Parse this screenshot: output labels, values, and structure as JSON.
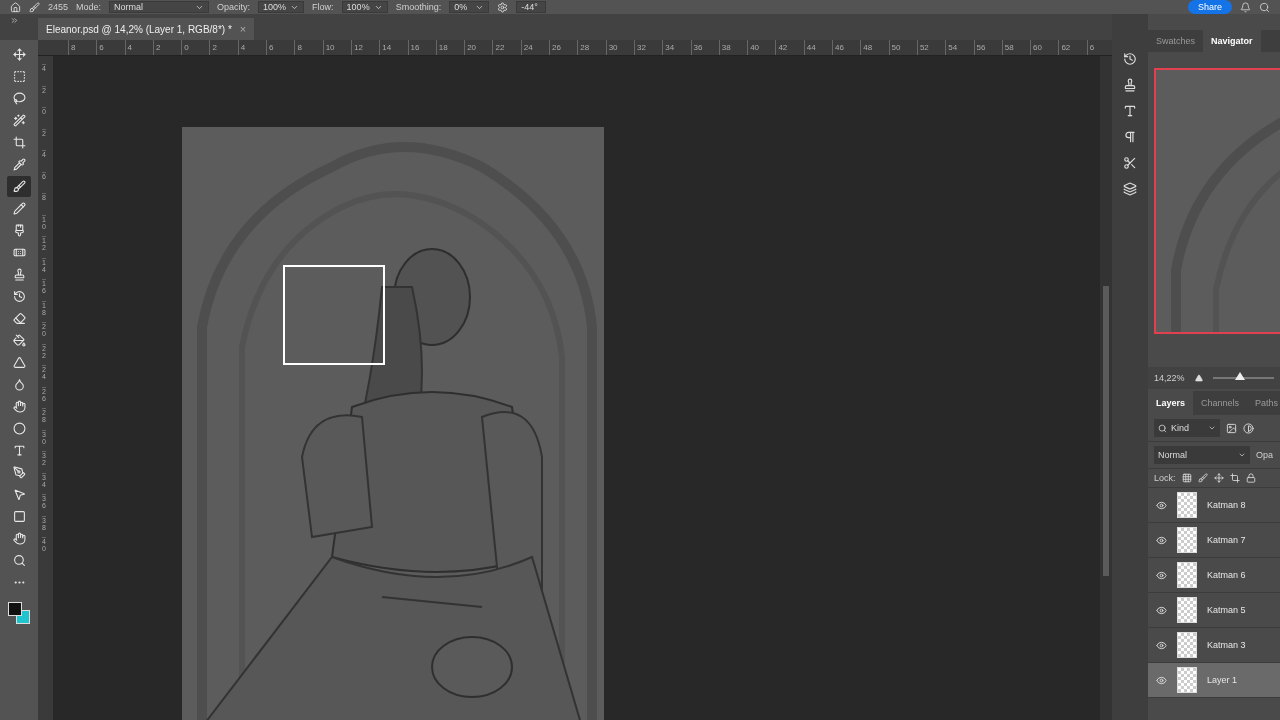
{
  "options_bar": {
    "brush_size": "2455",
    "mode_label": "Mode:",
    "mode": "Normal",
    "opacity_label": "Opacity:",
    "opacity": "100%",
    "flow_label": "Flow:",
    "flow": "100%",
    "smoothing_label": "Smoothing:",
    "smoothing": "0%",
    "angle": "-44°",
    "share": "Share"
  },
  "document_tab": {
    "title": "Eleanor.psd @ 14,2% (Layer 1, RGB/8*) *",
    "close": "×"
  },
  "tools": [
    {
      "kind": "move",
      "selected": false
    },
    {
      "kind": "marquee",
      "selected": false
    },
    {
      "kind": "lasso",
      "selected": false
    },
    {
      "kind": "wand",
      "selected": false
    },
    {
      "kind": "crop",
      "selected": false
    },
    {
      "kind": "eyedropper",
      "selected": false
    },
    {
      "kind": "brush",
      "selected": true
    },
    {
      "kind": "pencil",
      "selected": false
    },
    {
      "kind": "mixer",
      "selected": false
    },
    {
      "kind": "healing",
      "selected": false
    },
    {
      "kind": "stamp",
      "selected": false
    },
    {
      "kind": "history",
      "selected": false
    },
    {
      "kind": "eraser",
      "selected": false
    },
    {
      "kind": "bucket",
      "selected": false
    },
    {
      "kind": "blur",
      "selected": false
    },
    {
      "kind": "drop",
      "selected": false
    },
    {
      "kind": "smudge",
      "selected": false
    },
    {
      "kind": "sponge",
      "selected": false
    },
    {
      "kind": "type",
      "selected": false
    },
    {
      "kind": "pen",
      "selected": false
    },
    {
      "kind": "select",
      "selected": false
    },
    {
      "kind": "rect",
      "selected": false
    },
    {
      "kind": "hand",
      "selected": false
    },
    {
      "kind": "zoom",
      "selected": false
    },
    {
      "kind": "more",
      "selected": false
    }
  ],
  "ruler_h": [
    "8",
    "6",
    "4",
    "2",
    "0",
    "2",
    "4",
    "6",
    "8",
    "10",
    "12",
    "14",
    "16",
    "18",
    "20",
    "22",
    "24",
    "26",
    "28",
    "30",
    "32",
    "34",
    "36",
    "38",
    "40",
    "42",
    "44",
    "46",
    "48",
    "50",
    "52",
    "54",
    "56",
    "58",
    "60",
    "62",
    "6"
  ],
  "ruler_v": [
    "4",
    "2",
    "0",
    "2",
    "4",
    "6",
    "8",
    "10",
    "12",
    "14",
    "16",
    "18",
    "20",
    "22",
    "24",
    "26",
    "28",
    "30",
    "32",
    "34",
    "36",
    "38",
    "40"
  ],
  "navigator": {
    "tabs": [
      {
        "label": "Swatches",
        "selected": false
      },
      {
        "label": "Navigator",
        "selected": true
      }
    ],
    "zoom": "14,22%",
    "level": 0.45
  },
  "layers_panel": {
    "tabs": [
      {
        "label": "Layers",
        "selected": true
      },
      {
        "label": "Channels",
        "selected": false
      },
      {
        "label": "Paths",
        "selected": false
      }
    ],
    "filter": "Kind",
    "blend": "Normal",
    "opacity_label": "Opa",
    "lock_label": "Lock:",
    "layers": [
      {
        "name": "Katman 8",
        "visible": true,
        "selected": false
      },
      {
        "name": "Katman 7",
        "visible": true,
        "selected": false
      },
      {
        "name": "Katman 6",
        "visible": true,
        "selected": false
      },
      {
        "name": "Katman 5",
        "visible": true,
        "selected": false
      },
      {
        "name": "Katman 3",
        "visible": true,
        "selected": false
      },
      {
        "name": "Layer 1",
        "visible": true,
        "selected": true
      }
    ]
  }
}
